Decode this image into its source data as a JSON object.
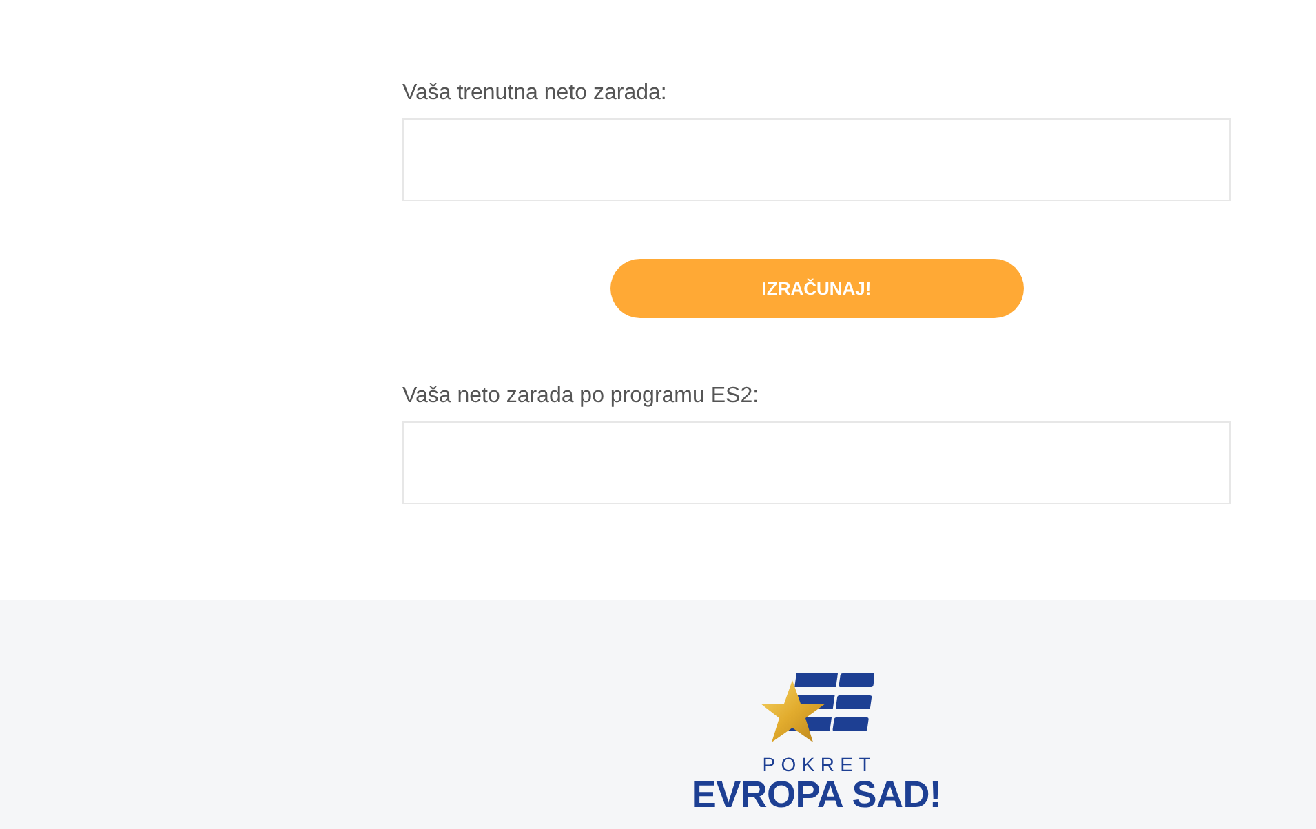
{
  "form": {
    "current_salary": {
      "label": "Vaša trenutna neto zarada:"
    },
    "calculate_button": {
      "label": "IZRAČUNAJ!"
    },
    "es2_salary": {
      "label": "Vaša neto zarada po programu ES2:"
    }
  },
  "footer": {
    "logo": {
      "subtitle": "POKRET",
      "title": "EVROPA SAD!"
    }
  }
}
